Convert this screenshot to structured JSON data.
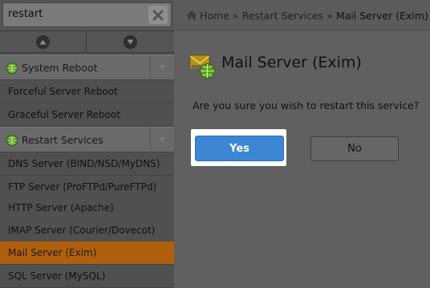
{
  "search": {
    "value": "restart"
  },
  "sidebar": {
    "categories": [
      {
        "label": "System Reboot",
        "icon": "green-globe-icon",
        "items": [
          {
            "label": "Forceful Server Reboot"
          },
          {
            "label": "Graceful Server Reboot"
          }
        ]
      },
      {
        "label": "Restart Services",
        "icon": "green-globe-icon",
        "items": [
          {
            "label": "DNS Server (BIND/NSD/MyDNS)"
          },
          {
            "label": "FTP Server (ProFTPd/PureFTPd)"
          },
          {
            "label": "HTTP Server (Apache)"
          },
          {
            "label": "IMAP Server (Courier/Dovecot)"
          },
          {
            "label": "Mail Server (Exim)",
            "active": true
          },
          {
            "label": "SQL Server (MySQL)"
          }
        ]
      }
    ]
  },
  "breadcrumb": {
    "items": [
      "Home",
      "Restart Services",
      "Mail Server (Exim)"
    ],
    "separator": "»"
  },
  "main": {
    "title": "Mail Server (Exim)",
    "prompt": "Are you sure you wish to restart this service?",
    "yes_label": "Yes",
    "no_label": "No"
  },
  "colors": {
    "active_item": "#b0600c",
    "primary_button": "#3d86d3",
    "category_icon": "#5a9e1e"
  }
}
